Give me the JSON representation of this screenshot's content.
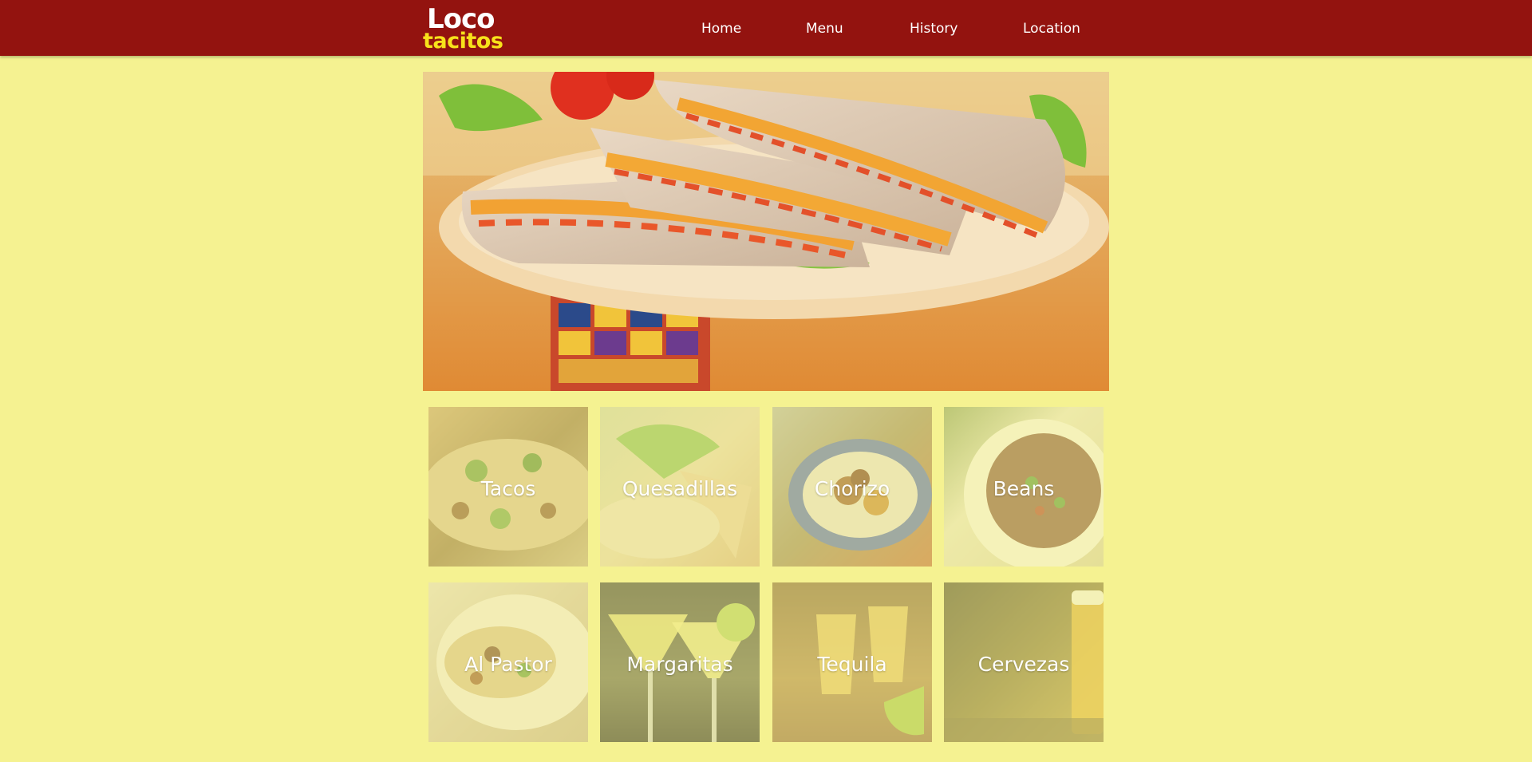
{
  "header": {
    "logo_line1": "Loco",
    "logo_line2": "tacitos",
    "nav": [
      {
        "label": "Home"
      },
      {
        "label": "Menu"
      },
      {
        "label": "History"
      },
      {
        "label": "Location"
      }
    ]
  },
  "tiles": [
    {
      "label": "Tacos"
    },
    {
      "label": "Quesadillas"
    },
    {
      "label": "Chorizo"
    },
    {
      "label": "Beans"
    },
    {
      "label": "Al Pastor"
    },
    {
      "label": "Margaritas"
    },
    {
      "label": "Tequila"
    },
    {
      "label": "Cervezas"
    }
  ],
  "colors": {
    "page_background": "#f5f291",
    "header_background": "#93130f",
    "logo_accent": "#f7e21b",
    "nav_text": "#ffffff"
  }
}
